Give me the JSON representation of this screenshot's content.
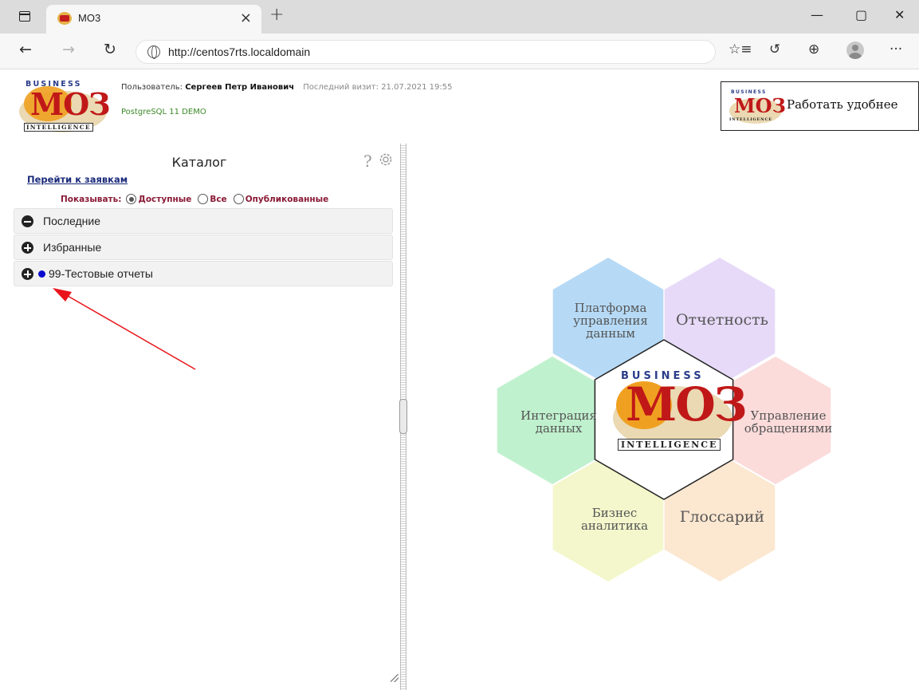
{
  "browser": {
    "tab_title": "MO3",
    "tab_close": "×",
    "new_tab": "+",
    "url": "http://centos7rts.localdomain",
    "window_controls": {
      "minimize": "—",
      "restore": "▢",
      "close": "✕"
    },
    "nav": {
      "back": "←",
      "forward": "→",
      "reload": "↻"
    },
    "tools": {
      "favorites": "☆≡",
      "history": "↺",
      "collections": "⊕",
      "more": "···"
    },
    "icons": [
      "tab-actions-icon",
      "globe-icon",
      "favorites-icon",
      "history-icon",
      "collections-icon",
      "profile-icon",
      "more-icon"
    ]
  },
  "header": {
    "logo": {
      "business": "BUSINESS",
      "name": "МОЗ",
      "intelligence": "INTELLIGENCE"
    },
    "user_label": "Пользователь:",
    "user_name": "Сергеев Петр Иванович",
    "last_visit_label": "Последний визит:",
    "last_visit_value": "21.07.2021 19:55",
    "database": "PostgreSQL 11 DEMO",
    "promo": {
      "business": "BUSINESS",
      "name": "МОЗ",
      "intelligence": "INTELLIGENCE",
      "text": "Работать удобнее"
    }
  },
  "catalog": {
    "title": "Каталог",
    "help": "?",
    "goto_requests": "Перейти к заявкам",
    "show_label": "Показывать:",
    "show_options": [
      {
        "label": "Доступные",
        "checked": true
      },
      {
        "label": "Все",
        "checked": false
      },
      {
        "label": "Опубликованные",
        "checked": false
      }
    ],
    "items": [
      {
        "label": "Последние",
        "expanded": true
      },
      {
        "label": "Избранные",
        "expanded": false
      },
      {
        "label": "99-Тестовые отчеты",
        "expanded": false,
        "dot_color": "#0a0acd"
      }
    ]
  },
  "diagram": {
    "hexes": [
      {
        "label_lines": [
          "Платформа",
          "управления",
          "данным"
        ],
        "color": "#a9d4f5"
      },
      {
        "label_lines": [
          "Отчетность"
        ],
        "color": "#e3d4f7"
      },
      {
        "label_lines": [
          "Интеграция",
          "данных"
        ],
        "color": "#b5eec5"
      },
      {
        "label_lines": [
          "Управление",
          "обращениями"
        ],
        "color": "#fbd5d5"
      },
      {
        "label_lines": [
          "Бизнес",
          "аналитика"
        ],
        "color": "#f1f6c2"
      },
      {
        "label_lines": [
          "Глоссарий"
        ],
        "color": "#fbe3c8"
      }
    ],
    "center": {
      "business": "BUSINESS",
      "name": "МОЗ",
      "intelligence": "INTELLIGENCE"
    }
  },
  "annotation": {
    "arrow_color": "#e8141a"
  }
}
